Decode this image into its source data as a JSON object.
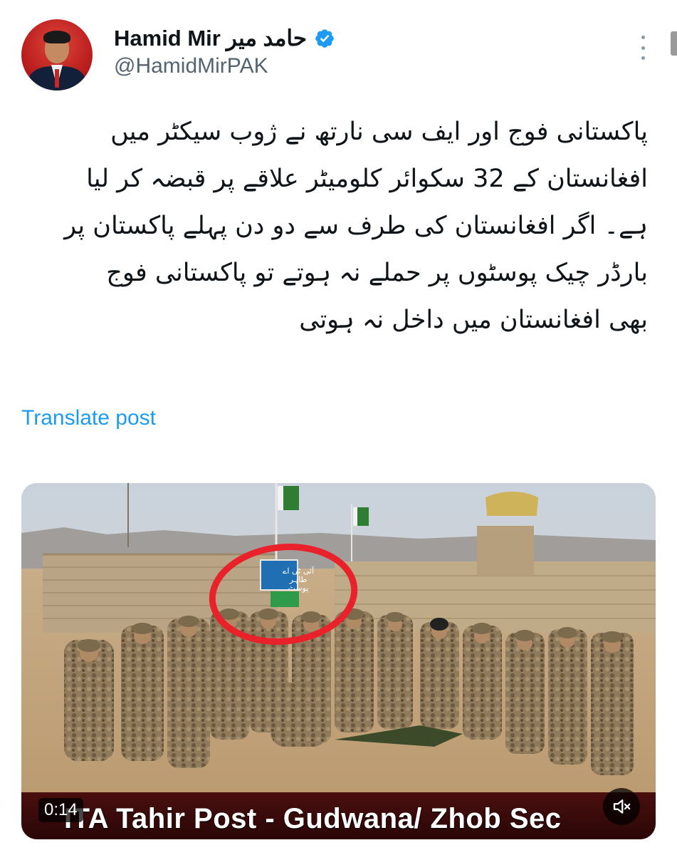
{
  "author": {
    "display_name": "Hamid Mir",
    "display_name_urdu": "حامد میر",
    "handle": "@HamidMirPAK",
    "verified": true,
    "avatar_icon": "profile-photo"
  },
  "post": {
    "lines": [
      "پاکستانی فوج اور ایف سی نارتھ نے ژوب سیکٹر میں",
      "افغانستان کے 32 سکوائر کلومیٹر علاقے پر قبضہ کر لیا",
      "ہے۔ اگر افغانستان کی طرف سے دو دن پہلے پاکستان پر",
      "بارڈر چیک پوسٹوں پر حملے نہ ہوتے تو پاکستانی فوج",
      "بھی افغانستان میں داخل نہ ہوتی"
    ],
    "translate_label": "Translate post"
  },
  "media": {
    "type": "video",
    "timestamp": "0:14",
    "caption": "ITA Tahir Post - Gudwana/ Zhob Sec",
    "sign_text": "آئی ٹی اے طاہر پوسٹ",
    "annotation": "red-circle",
    "mute_icon": "speaker-muted-icon"
  },
  "colors": {
    "link": "#1d9bf0",
    "verified": "#1d9bf0",
    "handle": "#536471",
    "caption_bar": "#3a0a0a",
    "annotation": "#e8212a"
  }
}
